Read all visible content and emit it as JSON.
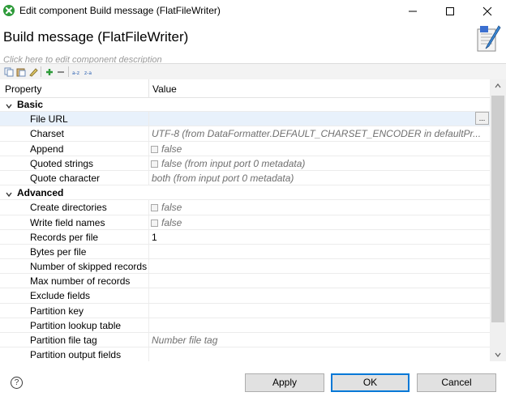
{
  "window": {
    "title": "Edit component Build message (FlatFileWriter)",
    "icon": "green-x-icon",
    "accent_color": "#0078d7"
  },
  "header": {
    "title": "Build message (FlatFileWriter)",
    "description_placeholder": "Click here to edit component description",
    "icon": "flat-file-writer-icon"
  },
  "toolbar": {
    "icons": [
      "copy-icon",
      "paste-icon",
      "clear-icon",
      "add-icon",
      "remove-icon",
      "sort-az-icon",
      "sort-za-icon"
    ]
  },
  "table": {
    "columns": [
      "Property",
      "Value"
    ],
    "categories": [
      {
        "label": "Basic",
        "rows": [
          {
            "label": "File URL",
            "value": "",
            "has_browse": true,
            "browse_label": "...",
            "selected": true
          },
          {
            "label": "Charset",
            "value": "UTF-8 (from DataFormatter.DEFAULT_CHARSET_ENCODER in defaultPr...",
            "italic": true
          },
          {
            "label": "Append",
            "value": "false",
            "italic": true,
            "checkbox": true
          },
          {
            "label": "Quoted strings",
            "value": "false (from input port 0 metadata)",
            "italic": true,
            "checkbox": true
          },
          {
            "label": "Quote character",
            "value": "both (from input port 0 metadata)",
            "italic": true
          }
        ]
      },
      {
        "label": "Advanced",
        "rows": [
          {
            "label": "Create directories",
            "value": "false",
            "italic": true,
            "checkbox": true
          },
          {
            "label": "Write field names",
            "value": "false",
            "italic": true,
            "checkbox": true
          },
          {
            "label": "Records per file",
            "value": "1"
          },
          {
            "label": "Bytes per file",
            "value": ""
          },
          {
            "label": "Number of skipped records",
            "value": ""
          },
          {
            "label": "Max number of records",
            "value": ""
          },
          {
            "label": "Exclude fields",
            "value": ""
          },
          {
            "label": "Partition key",
            "value": ""
          },
          {
            "label": "Partition lookup table",
            "value": ""
          },
          {
            "label": "Partition file tag",
            "value": "Number file tag",
            "italic": true
          },
          {
            "label": "Partition output fields",
            "value": ""
          }
        ]
      }
    ]
  },
  "footer": {
    "help_label": "?",
    "apply_label": "Apply",
    "ok_label": "OK",
    "cancel_label": "Cancel"
  }
}
